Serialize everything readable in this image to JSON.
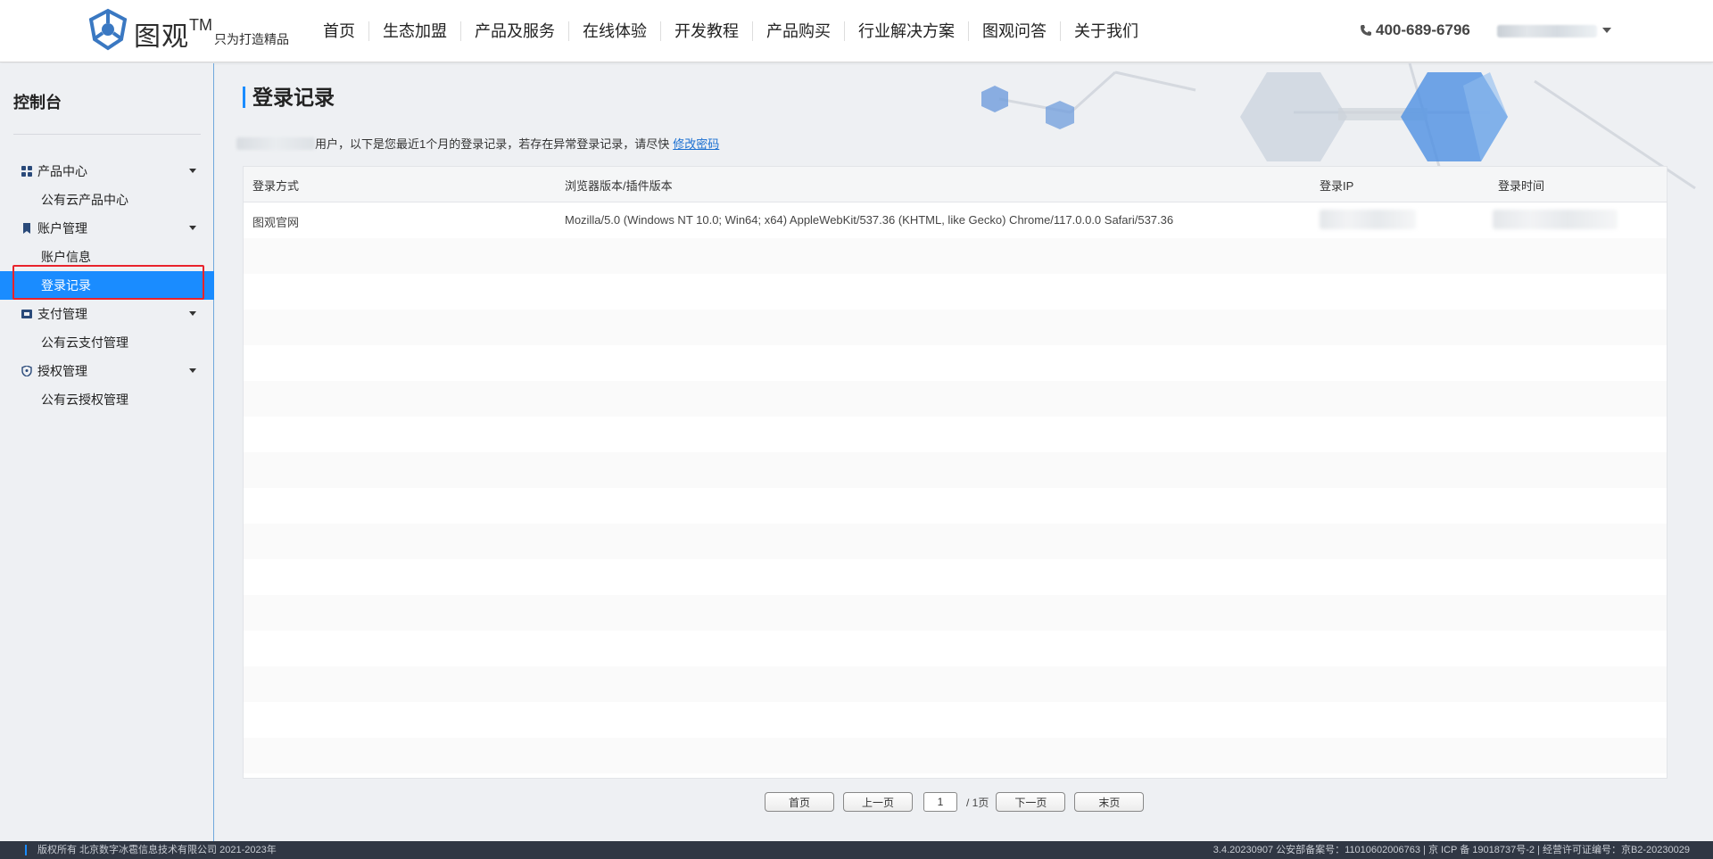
{
  "header": {
    "brand": "图观",
    "tm": "TM",
    "slogan": "只为打造精品",
    "nav": [
      "首页",
      "生态加盟",
      "产品及服务",
      "在线体验",
      "开发教程",
      "产品购买",
      "行业解决方案",
      "图观问答",
      "关于我们"
    ],
    "phone": "400-689-6796"
  },
  "sidebar": {
    "title": "控制台",
    "groups": [
      {
        "label": "产品中心",
        "icon": "grid-icon",
        "sub": "公有云产品中心"
      },
      {
        "label": "账户管理",
        "icon": "bookmark-icon",
        "subs": [
          "账户信息",
          "登录记录"
        ]
      },
      {
        "label": "支付管理",
        "icon": "ticket-icon",
        "sub": "公有云支付管理"
      },
      {
        "label": "授权管理",
        "icon": "shield-icon",
        "sub": "公有云授权管理"
      }
    ]
  },
  "main": {
    "title": "登录记录",
    "notice_text": "用户，以下是您最近1个月的登录记录，若存在异常登录记录，请尽快",
    "notice_link": "修改密码",
    "columns": [
      "登录方式",
      "浏览器版本/插件版本",
      "登录IP",
      "登录时间"
    ],
    "rows": [
      {
        "method": "图观官网",
        "browser": "Mozilla/5.0 (Windows NT 10.0; Win64; x64) AppleWebKit/537.36 (KHTML, like Gecko) Chrome/117.0.0.0 Safari/537.36"
      }
    ],
    "pager": {
      "first": "首页",
      "prev": "上一页",
      "current": "1",
      "total": "/ 1页",
      "next": "下一页",
      "last": "末页"
    }
  },
  "footer": {
    "left": "版权所有 北京数字冰雹信息技术有限公司 2021-2023年",
    "right": "3.4.20230907 公安部备案号：11010602006763 | 京 ICP 备 19018737号-2 | 经营许可证编号：京B2-20230029"
  },
  "colors": {
    "accent": "#1a8cff",
    "highlight_border": "#e8232b",
    "footer_bg": "#303744"
  }
}
